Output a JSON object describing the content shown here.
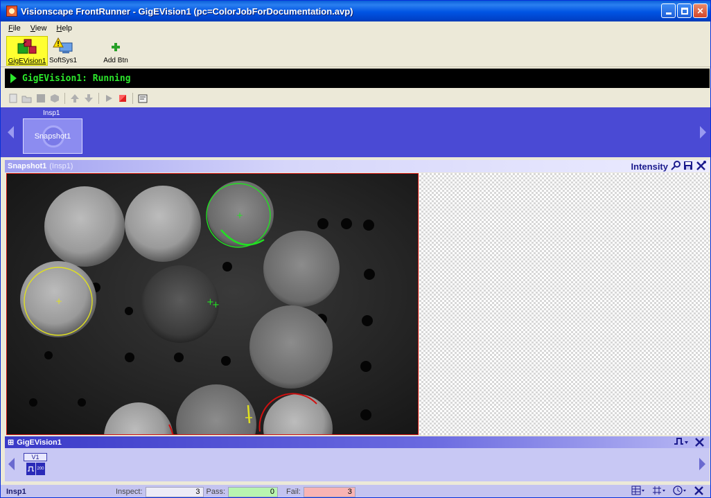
{
  "window": {
    "title": "Visionscape FrontRunner - GigEVision1 (pc=ColorJobForDocumentation.avp)",
    "min": "minimize",
    "max": "maximize",
    "close": "✕"
  },
  "menu": [
    "File",
    "View",
    "Help"
  ],
  "devices": [
    {
      "label": "GigEVision1",
      "icon": "camera-device-icon",
      "selected": true
    },
    {
      "label": "SoftSys1",
      "icon": "warning-monitor-icon",
      "selected": false
    },
    {
      "label": "Add Btn",
      "icon": "add-plus-icon",
      "selected": false
    }
  ],
  "run_status": "GigEVision1: Running",
  "command_toolbar": [
    "new-icon",
    "open-icon",
    "stop-square-icon",
    "cube-icon",
    "upload-icon",
    "download-icon",
    "play-icon",
    "stop-red-icon",
    "properties-icon"
  ],
  "inspection": {
    "label": "Insp1",
    "step": "Snapshot1"
  },
  "image_panel": {
    "step": "Snapshot1",
    "insp": "(Insp1)",
    "mode": "Intensity",
    "icons": [
      "zoom-icon",
      "save-icon",
      "tools-icon"
    ]
  },
  "gige_panel": {
    "title": "GigEVision1",
    "expand": "⊞",
    "v_label": "V1",
    "v_value": "200",
    "right_icons": [
      "trigger-icon",
      "tools-icon"
    ]
  },
  "statusbar": {
    "insp": "Insp1",
    "inspect_label": "Inspect:",
    "inspect_value": "3",
    "pass_label": "Pass:",
    "pass_value": "0",
    "fail_label": "Fail:",
    "fail_value": "3",
    "colors": {
      "inspect": "#ecebf6",
      "pass": "#b8f4b0",
      "fail": "#f8b4b4"
    }
  }
}
